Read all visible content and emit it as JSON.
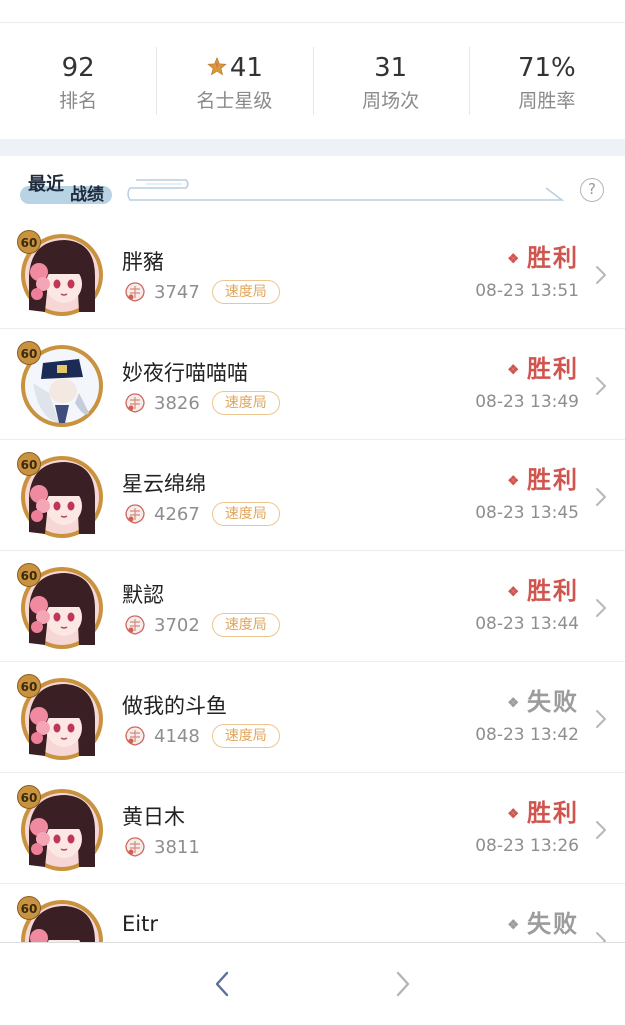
{
  "stats": [
    {
      "value": "92",
      "label": "排名",
      "icon": "none"
    },
    {
      "value": "41",
      "label": "名士星级",
      "icon": "star-icon"
    },
    {
      "value": "31",
      "label": "周场次",
      "icon": "none"
    },
    {
      "value": "71%",
      "label": "周胜率",
      "icon": "none"
    }
  ],
  "section": {
    "title_part1": "最近",
    "title_part2": "战绩",
    "help": "?"
  },
  "matches": [
    {
      "name": "胖豬",
      "level": "60",
      "score": "3747",
      "tag": "速度局",
      "result": "胜利",
      "outcome": "win",
      "time": "08-23 13:51",
      "avatar": "girl"
    },
    {
      "name": "妙夜行喵喵喵",
      "level": "60",
      "score": "3826",
      "tag": "速度局",
      "result": "胜利",
      "outcome": "win",
      "time": "08-23 13:49",
      "avatar": "elder"
    },
    {
      "name": "星云绵绵",
      "level": "60",
      "score": "4267",
      "tag": "速度局",
      "result": "胜利",
      "outcome": "win",
      "time": "08-23 13:45",
      "avatar": "girl"
    },
    {
      "name": "默認",
      "level": "60",
      "score": "3702",
      "tag": "速度局",
      "result": "胜利",
      "outcome": "win",
      "time": "08-23 13:44",
      "avatar": "girl"
    },
    {
      "name": "做我的斗鱼",
      "level": "60",
      "score": "4148",
      "tag": "速度局",
      "result": "失败",
      "outcome": "lose",
      "time": "08-23 13:42",
      "avatar": "girl"
    },
    {
      "name": "黄日木",
      "level": "60",
      "score": "3811",
      "tag": "",
      "result": "胜利",
      "outcome": "win",
      "time": "08-23 13:26",
      "avatar": "girl"
    },
    {
      "name": "Eitr",
      "level": "60",
      "score": "",
      "tag": "",
      "result": "失败",
      "outcome": "lose",
      "time": "",
      "avatar": "girl"
    }
  ],
  "colors": {
    "win": "#d0554f",
    "lose": "#9c9c9c",
    "tag": "#e0a65a",
    "avatar_ring": "#c9923f"
  },
  "nav": {
    "back_icon": "chevron-left-icon",
    "forward_icon": "chevron-right-icon"
  }
}
